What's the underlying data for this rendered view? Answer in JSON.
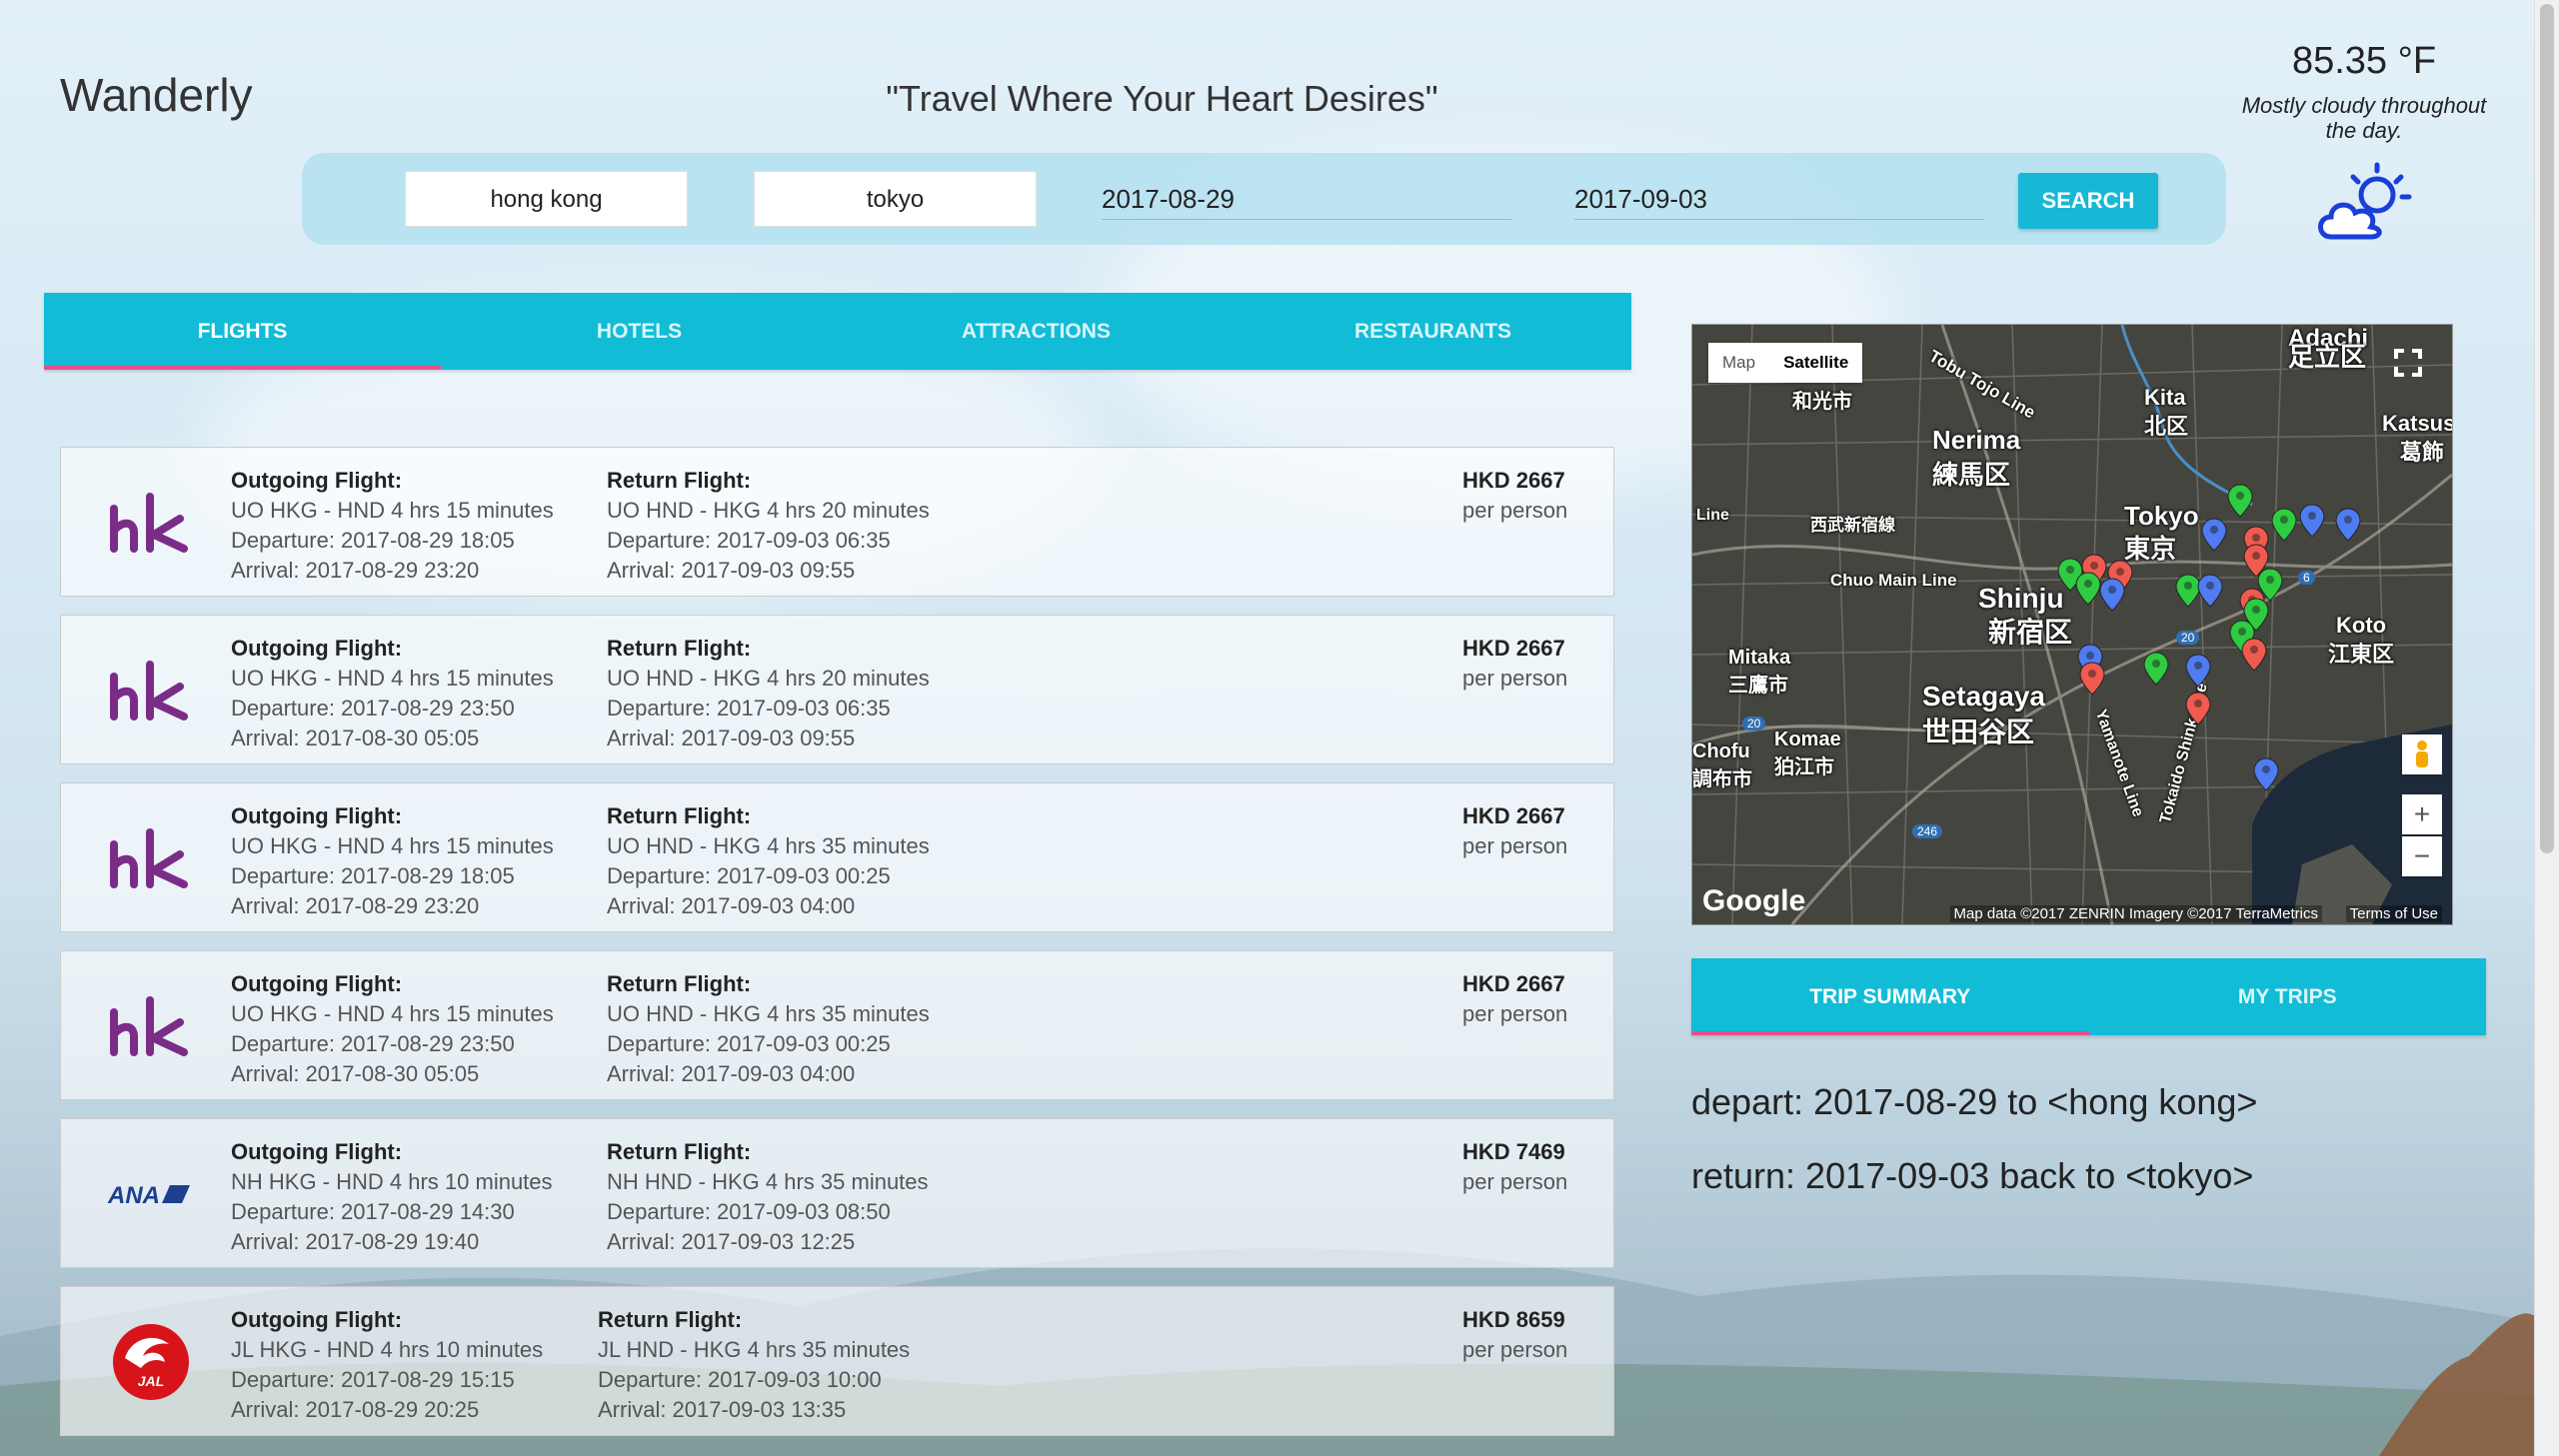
{
  "app": {
    "name": "Wanderly",
    "tagline": "\"Travel Where Your Heart Desires\""
  },
  "search": {
    "origin": "hong kong",
    "destination": "tokyo",
    "depart_date": "2017-08-29",
    "return_date": "2017-09-03",
    "button_label": "SEARCH"
  },
  "weather": {
    "temp": "85.35 °F",
    "description": "Mostly cloudy throughout the day.",
    "icon": "partly-cloudy-icon"
  },
  "main_tabs": [
    {
      "label": "FLIGHTS",
      "active": true
    },
    {
      "label": "HOTELS",
      "active": false
    },
    {
      "label": "ATTRACTIONS",
      "active": false
    },
    {
      "label": "RESTAURANTS",
      "active": false
    }
  ],
  "flights": [
    {
      "airline": "HK Express",
      "logo": "hk-express-logo",
      "out_head": "Outgoing Flight:",
      "out_route": "UO HKG - HND 4 hrs 15 minutes",
      "out_dep": "Departure: 2017-08-29 18:05",
      "out_arr": "Arrival: 2017-08-29 23:20",
      "ret_head": "Return Flight:",
      "ret_route": "UO HND - HKG 4 hrs 20 minutes",
      "ret_dep": "Departure: 2017-09-03 06:35",
      "ret_arr": "Arrival: 2017-09-03 09:55",
      "price": "HKD 2667",
      "price_unit": "per person"
    },
    {
      "airline": "HK Express",
      "logo": "hk-express-logo",
      "out_head": "Outgoing Flight:",
      "out_route": "UO HKG - HND 4 hrs 15 minutes",
      "out_dep": "Departure: 2017-08-29 23:50",
      "out_arr": "Arrival: 2017-08-30 05:05",
      "ret_head": "Return Flight:",
      "ret_route": "UO HND - HKG 4 hrs 20 minutes",
      "ret_dep": "Departure: 2017-09-03 06:35",
      "ret_arr": "Arrival: 2017-09-03 09:55",
      "price": "HKD 2667",
      "price_unit": "per person"
    },
    {
      "airline": "HK Express",
      "logo": "hk-express-logo",
      "out_head": "Outgoing Flight:",
      "out_route": "UO HKG - HND 4 hrs 15 minutes",
      "out_dep": "Departure: 2017-08-29 18:05",
      "out_arr": "Arrival: 2017-08-29 23:20",
      "ret_head": "Return Flight:",
      "ret_route": "UO HND - HKG 4 hrs 35 minutes",
      "ret_dep": "Departure: 2017-09-03 00:25",
      "ret_arr": "Arrival: 2017-09-03 04:00",
      "price": "HKD 2667",
      "price_unit": "per person"
    },
    {
      "airline": "HK Express",
      "logo": "hk-express-logo",
      "out_head": "Outgoing Flight:",
      "out_route": "UO HKG - HND 4 hrs 15 minutes",
      "out_dep": "Departure: 2017-08-29 23:50",
      "out_arr": "Arrival: 2017-08-30 05:05",
      "ret_head": "Return Flight:",
      "ret_route": "UO HND - HKG 4 hrs 35 minutes",
      "ret_dep": "Departure: 2017-09-03 00:25",
      "ret_arr": "Arrival: 2017-09-03 04:00",
      "price": "HKD 2667",
      "price_unit": "per person"
    },
    {
      "airline": "ANA",
      "logo": "ana-logo",
      "out_head": "Outgoing Flight:",
      "out_route": "NH HKG - HND 4 hrs 10 minutes",
      "out_dep": "Departure: 2017-08-29 14:30",
      "out_arr": "Arrival: 2017-08-29 19:40",
      "ret_head": "Return Flight:",
      "ret_route": "NH HND - HKG 4 hrs 35 minutes",
      "ret_dep": "Departure: 2017-09-03 08:50",
      "ret_arr": "Arrival: 2017-09-03 12:25",
      "price": "HKD 7469",
      "price_unit": "per person"
    },
    {
      "airline": "JAL",
      "logo": "jal-logo",
      "out_head": "Outgoing Flight:",
      "out_route": "JL HKG - HND 4 hrs 10 minutes",
      "out_dep": "Departure: 2017-08-29 15:15",
      "out_arr": "Arrival: 2017-08-29 20:25",
      "ret_head": "Return Flight:",
      "ret_route": "JL HND - HKG 4 hrs 35 minutes",
      "ret_dep": "Departure: 2017-09-03 10:00",
      "ret_arr": "Arrival: 2017-09-03 13:35",
      "price": "HKD 8659",
      "price_unit": "per person"
    }
  ],
  "map": {
    "type_map": "Map",
    "type_satellite": "Satellite",
    "labels": {
      "adachi": "Adachi",
      "adachi_jp": "足立区",
      "kita": "Kita",
      "kita_jp": "北区",
      "katsus": "Katsus",
      "katsus_jp": "葛飾",
      "nerima": "Nerima",
      "nerima_jp": "練馬区",
      "tokyo": "Tokyo",
      "tokyo_jp": "東京",
      "shinjuku": "Shinju",
      "shinjuku_jp": "新宿区",
      "koto": "Koto",
      "koto_jp": "江東区",
      "mitaka": "Mitaka",
      "mitaka_jp": "三鷹市",
      "setagaya": "Setagaya",
      "setagaya_jp": "世田谷区",
      "komae": "Komae",
      "komae_jp": "狛江市",
      "chofu": "Chofu",
      "chofu_jp": "調布市",
      "wako_jp": "和光市",
      "seibu": "西武新宿線",
      "chuo": "Chuo Main Line",
      "tobu": "Tobu Tojo Line",
      "line": "Line",
      "yamanote": "Yamanote Line",
      "tokaido": "Tokaido Shinkanse"
    },
    "road_badges": [
      "20",
      "20",
      "246",
      "6"
    ],
    "zoom_in": "+",
    "zoom_out": "−",
    "google": "Google",
    "attribution": "Map data ©2017 ZENRIN Imagery ©2017 TerraMetrics",
    "terms": "Terms of Use"
  },
  "side_tabs": [
    {
      "label": "TRIP SUMMARY",
      "active": true
    },
    {
      "label": "MY TRIPS",
      "active": false
    }
  ],
  "trip_summary": {
    "depart": "depart: 2017-08-29 to <hong kong>",
    "return": "return: 2017-09-03 back to <tokyo>"
  },
  "colors": {
    "accent": "#12bcd7",
    "tab_indicator": "#e94c8c",
    "hk_purple": "#7b2c87",
    "ana_blue": "#1d3f8f",
    "jal_red": "#d8141b"
  }
}
